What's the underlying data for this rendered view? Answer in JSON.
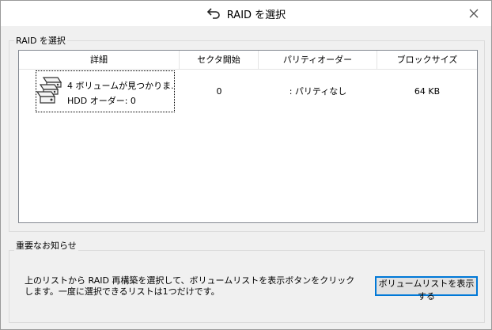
{
  "window": {
    "title": "RAID を選択",
    "title_icon": "back-arrow-icon",
    "close_icon": "close-icon"
  },
  "raid_group": {
    "label": "RAID を選択",
    "columns": [
      "詳細",
      "セクタ開始",
      "パリティオーダー",
      "ブロックサイズ"
    ],
    "rows": [
      {
        "icon": "hdd-stack-icon",
        "detail_line1": "4 ボリュームが見つかりま...",
        "detail_line2": "HDD オーダー:  0",
        "sector_start": "0",
        "parity_order": ": パリティなし",
        "block_size": "64 KB"
      }
    ]
  },
  "notice_group": {
    "label": "重要なお知らせ",
    "text": "上のリストから RAID 再構築を選択して、ボリュームリストを表示ボタンをクリックします。一度に選択できるリストは1つだけです。",
    "button_label": "ボリュームリストを表示する"
  }
}
